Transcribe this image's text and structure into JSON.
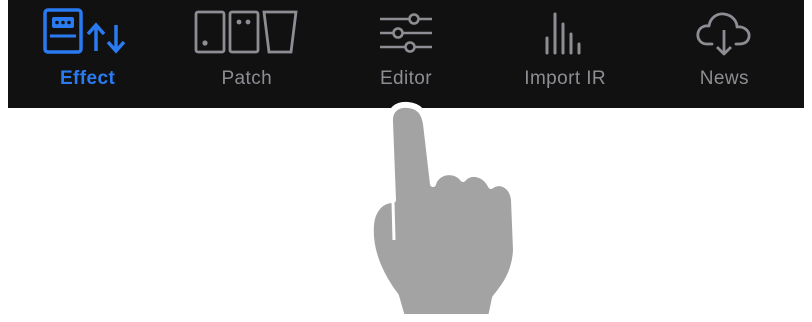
{
  "tab_bar": {
    "active_color": "#2a7bf2",
    "inactive_color": "#8d8d93",
    "background_color": "#111111",
    "tabs": [
      {
        "label": "Effect",
        "icon": "effect-pedal-swap-icon",
        "active": true
      },
      {
        "label": "Patch",
        "icon": "patch-pedals-icon",
        "active": false
      },
      {
        "label": "Editor",
        "icon": "editor-sliders-icon",
        "active": false
      },
      {
        "label": "Import IR",
        "icon": "import-ir-bars-icon",
        "active": false
      },
      {
        "label": "News",
        "icon": "news-cloud-download-icon",
        "active": false
      }
    ]
  },
  "pointer": {
    "icon": "pointing-hand-icon",
    "color": "#a3a3a3",
    "target_tab": "Editor"
  }
}
